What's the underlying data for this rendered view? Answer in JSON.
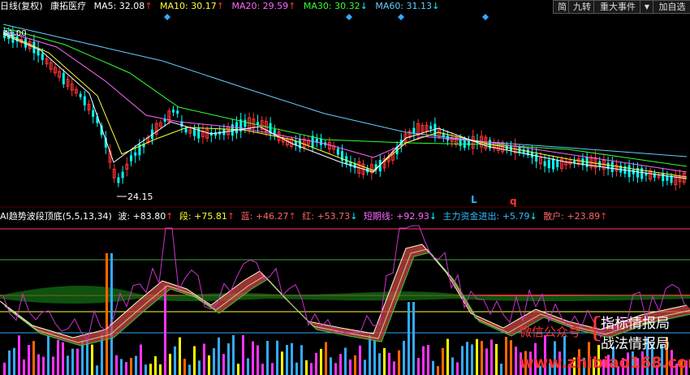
{
  "main_header": {
    "period": "日线(复权)",
    "stock_name": "康拓医疗",
    "ma5": {
      "label": "MA5: 32.08",
      "arrow": "↑",
      "color": "#ffffff"
    },
    "ma10": {
      "label": "MA10: 30.17",
      "arrow": "↑",
      "color": "#ffff33"
    },
    "ma20": {
      "label": "MA20: 29.59",
      "arrow": "↑",
      "color": "#ff66ff"
    },
    "ma30": {
      "label": "MA30: 30.32",
      "arrow": "↓",
      "color": "#33ff33"
    },
    "ma60": {
      "label": "MA60: 31.13",
      "arrow": "↓",
      "color": "#66ccff"
    }
  },
  "toolbar": {
    "simple": "简",
    "nine_turn": "九转",
    "major_events": "重大事件",
    "dropdown": "▼",
    "add_self": "加自选"
  },
  "main_chart": {
    "price_label_top": "41.00",
    "price_label_low": "24.15",
    "marker_l": "L",
    "marker_q": "q"
  },
  "indicator_header": {
    "title": "AI趋势波段顶底(5,5,13,34)",
    "items": [
      {
        "label": "波: +83.80",
        "arrow": "↑",
        "color": "#ffffff"
      },
      {
        "label": "段: +75.81",
        "arrow": "↑",
        "color": "#ffff33"
      },
      {
        "label": "蓝: +46.27",
        "arrow": "↑",
        "color": "#ff6666"
      },
      {
        "label": "红: +53.73",
        "arrow": "↓",
        "color": "#ff6666"
      },
      {
        "label": "短期线: +92.93",
        "arrow": "↓",
        "color": "#ff66ff"
      },
      {
        "label": "主力资金进出: +5.79",
        "arrow": "↓",
        "color": "#33bbff"
      },
      {
        "label": "散户: +23.89",
        "arrow": "↑",
        "color": "#ff6666"
      }
    ]
  },
  "watermark": {
    "wechat": "微信公众号",
    "brace": "{",
    "line1": "指标情报局",
    "line2": "战法情报局",
    "site": "www.zhibiao168.com"
  },
  "colors": {
    "up": "#ff3333",
    "down": "#00ffff",
    "ma5": "#ffffff",
    "ma10": "#ffff33",
    "ma20": "#ff66ff",
    "ma30": "#33ff33",
    "ma60": "#66ccff"
  },
  "icons": {
    "event_marker": "diamond-icon"
  }
}
